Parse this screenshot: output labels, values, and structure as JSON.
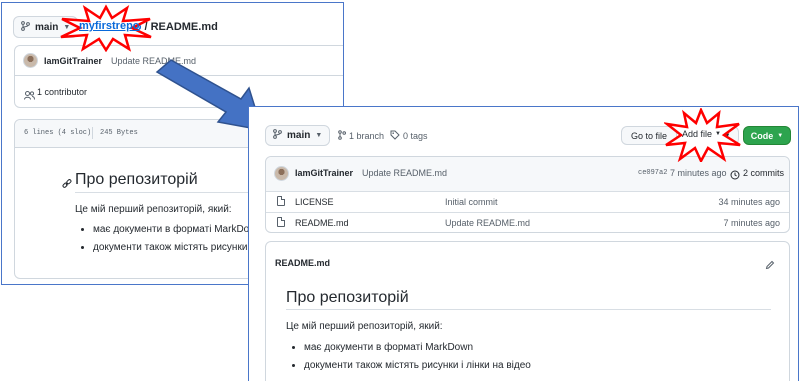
{
  "back_window": {
    "branch": "main",
    "repo_name": "myfirstrepo",
    "separator": "/",
    "file_name": "README.md",
    "commit": {
      "author": "IamGitTrainer",
      "message": "Update README.md"
    },
    "contributors": "1 contributor",
    "file_stats": {
      "lines": "6 lines (4 sloc)",
      "size": "245 Bytes"
    },
    "readme": {
      "heading": "Про репозиторій",
      "intro": "Це мій перший репозиторій, який:",
      "items": [
        "має документи в форматі MarkDown",
        "документи також містять рисунки і л"
      ]
    }
  },
  "front_window": {
    "branch": "main",
    "branches": "1 branch",
    "tags": "0 tags",
    "go_to_file": "Go to file",
    "add_file": "Add file",
    "code": "Code",
    "latest_commit": {
      "author": "IamGitTrainer",
      "message": "Update README.md",
      "hash": "ce097a2",
      "time": "7 minutes ago",
      "commits": "2 commits"
    },
    "files": [
      {
        "name": "LICENSE",
        "message": "Initial commit",
        "time": "34 minutes ago"
      },
      {
        "name": "README.md",
        "message": "Update README.md",
        "time": "7 minutes ago"
      }
    ],
    "readme": {
      "title": "README.md",
      "heading": "Про репозиторій",
      "intro": "Це мій перший репозиторій, який:",
      "items": [
        "має документи в форматі MarkDown",
        "документи також містять рисунки і лінки на відео"
      ]
    }
  },
  "colors": {
    "highlight_star": "#ff0000",
    "arrow": "#4472c4",
    "code_button": "#2da44e",
    "link": "#0969da"
  }
}
